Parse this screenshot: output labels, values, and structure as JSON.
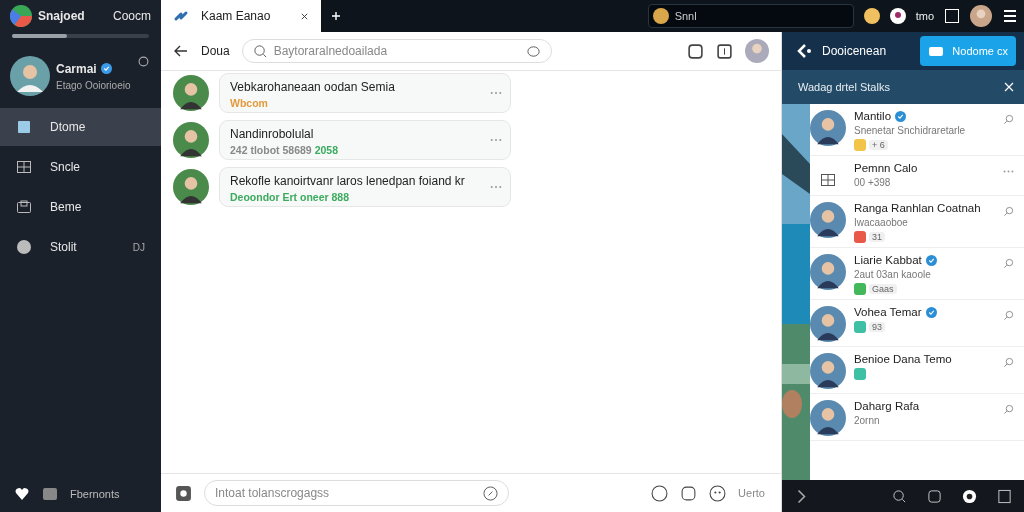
{
  "sidebar": {
    "app_name": "Snajoed",
    "app_action": "Coocm",
    "progress": {
      "level": 0.4
    },
    "profile": {
      "name": "Carmai",
      "verified": true,
      "status": "Etago Ooiorioeio"
    },
    "items": [
      {
        "label": "Dtome",
        "selected": true
      },
      {
        "label": "Sncle",
        "selected": false
      },
      {
        "label": "Beme",
        "selected": false
      },
      {
        "label": "Stolit",
        "selected": false,
        "badge": "DJ"
      }
    ],
    "footer": "Fbernonts"
  },
  "browser": {
    "tab": {
      "title": "Kaam Eanao",
      "selected": true
    },
    "search": {
      "value": "Snnl"
    },
    "count": "tmo"
  },
  "chat": {
    "back_label": "Doua",
    "search": {
      "placeholder": "Baytoraralnedoailada"
    },
    "messages": [
      {
        "text": "Vebkarohaneaan oodan Semia",
        "meta": "Wbcom",
        "color": "#e39a3a"
      },
      {
        "text": "Nandinrobolulal",
        "meta": "242 tlobot 58689 **2058**",
        "color": "#888888"
      },
      {
        "text": "Rekofle kanoirtvanr laros lenedpan foiand kr",
        "meta": "Deoondor Ert oneer 888",
        "color": "#3bab5e"
      }
    ],
    "composer": {
      "placeholder": "Intoat tolanscrogagss",
      "send_label": "Uerto"
    }
  },
  "panel": {
    "title": "Dooicenean",
    "button": "Nodome cx",
    "subtitle": "Wadag drtel Stalks",
    "contacts": [
      {
        "kind": "person",
        "name": "Mantilo",
        "verified": true,
        "line": "Snenetar Snchidraretarle",
        "tag": "+ 6",
        "color": "#f3c44a"
      },
      {
        "kind": "group",
        "name": "Pemnn Calo",
        "verified": false,
        "line": "00 +398"
      },
      {
        "kind": "person",
        "name": "Ranga Ranhlan Coatnah",
        "verified": false,
        "line": "Iwacaaoboe",
        "tag": "31",
        "color": "#e8594a"
      },
      {
        "kind": "person",
        "name": "Liarie Kabbat",
        "verified": true,
        "line": "2aut 03an kaoole",
        "tag": "Gaas",
        "color": "#43b85a"
      },
      {
        "kind": "person",
        "name": "Vohea Temar",
        "verified": true,
        "tag": "93",
        "color": "#3fbfa4"
      },
      {
        "kind": "person",
        "name": "Benioe Dana Temo",
        "verified": false,
        "color": "#3fbfa4"
      },
      {
        "kind": "person",
        "name": "Daharg Rafa",
        "verified": false,
        "line": "2ornn"
      }
    ]
  }
}
